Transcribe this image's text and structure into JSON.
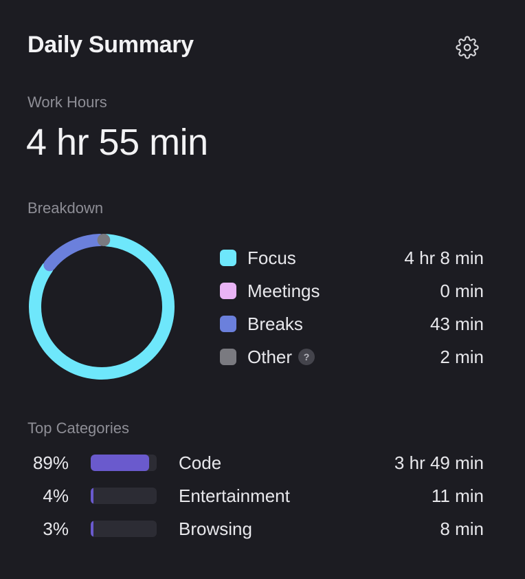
{
  "header": {
    "title": "Daily Summary",
    "settings_icon": "gear-icon"
  },
  "work_hours": {
    "label": "Work Hours",
    "value": "4 hr 55 min"
  },
  "breakdown": {
    "label": "Breakdown",
    "items": [
      {
        "label": "Focus",
        "value": "4 hr 8 min",
        "minutes": 248,
        "color": "#6ee7fb"
      },
      {
        "label": "Meetings",
        "value": "0 min",
        "minutes": 0,
        "color": "#e9b3f5"
      },
      {
        "label": "Breaks",
        "value": "43 min",
        "minutes": 43,
        "color": "#6b80dc"
      },
      {
        "label": "Other",
        "value": "2 min",
        "minutes": 2,
        "color": "#7a7a80",
        "help": "?"
      }
    ]
  },
  "top_categories": {
    "label": "Top Categories",
    "items": [
      {
        "percent": "89%",
        "fraction": 0.89,
        "name": "Code",
        "value": "3 hr 49 min"
      },
      {
        "percent": "4%",
        "fraction": 0.04,
        "name": "Entertainment",
        "value": "11 min"
      },
      {
        "percent": "3%",
        "fraction": 0.03,
        "name": "Browsing",
        "value": "8 min"
      }
    ],
    "bar_color": "#6a5acd",
    "track_color": "#2c2c34"
  },
  "colors": {
    "background": "#1c1c22",
    "text": "#e8e8ec",
    "muted": "#8e8e96"
  }
}
